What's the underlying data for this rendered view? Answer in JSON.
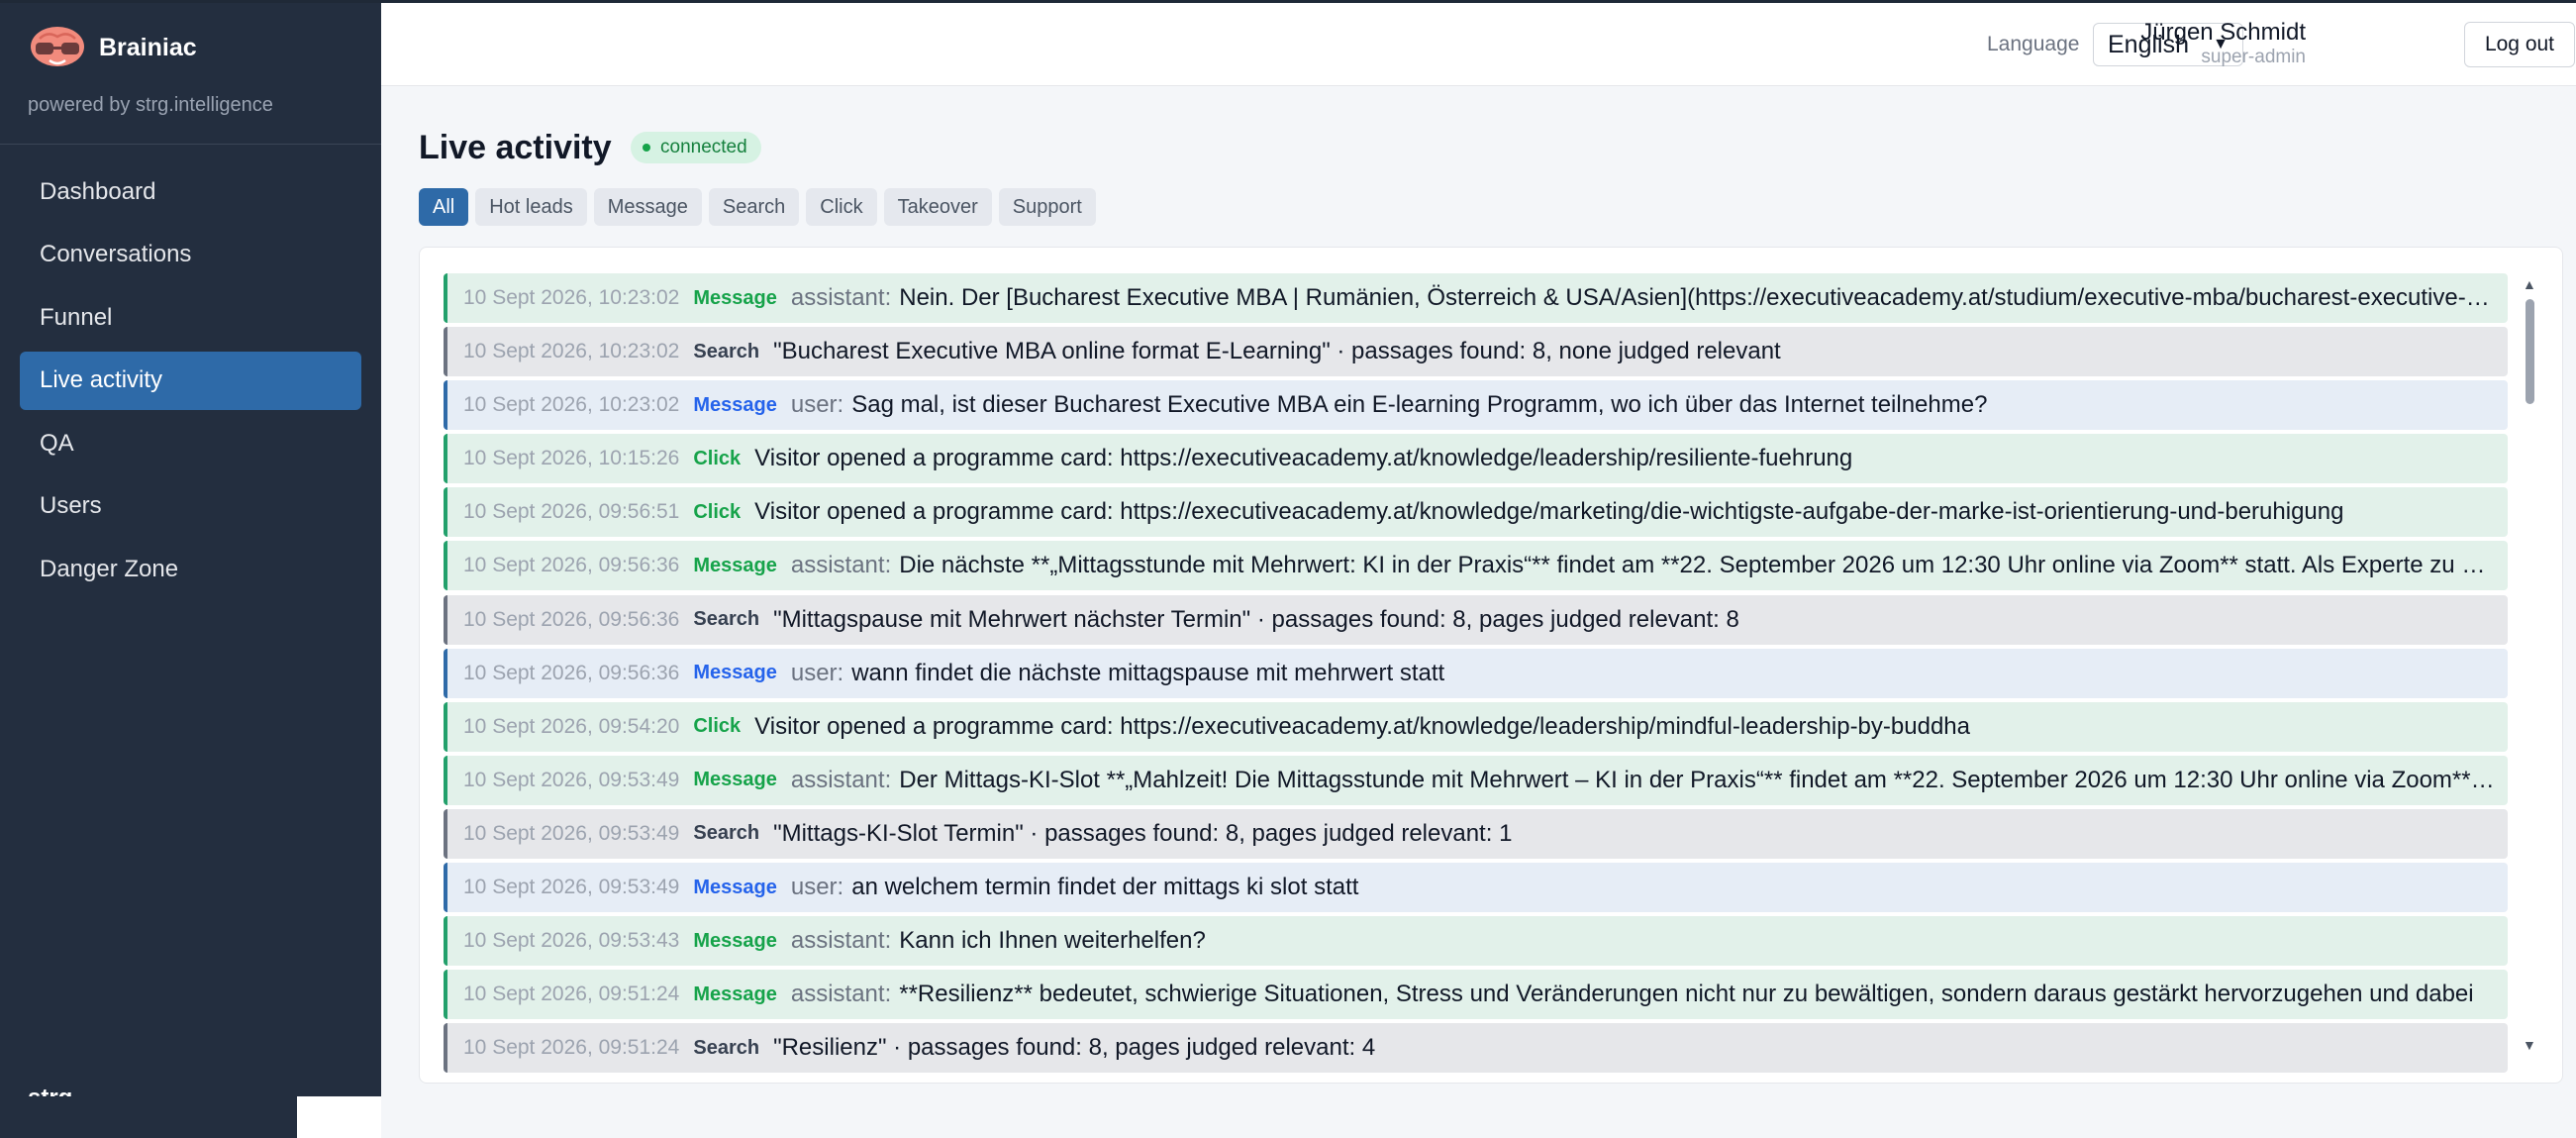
{
  "app": {
    "name": "Brainiac",
    "powered_by": "powered by strg.intelligence",
    "footer_logo": "strg"
  },
  "sidebar": {
    "items": [
      {
        "label": "Dashboard"
      },
      {
        "label": "Conversations"
      },
      {
        "label": "Funnel"
      },
      {
        "label": "Live activity",
        "active": true
      },
      {
        "label": "QA"
      },
      {
        "label": "Users"
      },
      {
        "label": "Danger Zone"
      }
    ]
  },
  "header": {
    "language_label": "Language",
    "language_value": "English",
    "user_name": "Jürgen Schmidt",
    "user_role": "super-admin",
    "logout_label": "Log out"
  },
  "page": {
    "title": "Live activity",
    "status": "connected"
  },
  "filters": [
    {
      "label": "All",
      "active": true
    },
    {
      "label": "Hot leads"
    },
    {
      "label": "Message"
    },
    {
      "label": "Search"
    },
    {
      "label": "Click"
    },
    {
      "label": "Takeover"
    },
    {
      "label": "Support"
    }
  ],
  "feed": [
    {
      "time": "10 Sept 2026, 10:23:02",
      "type": "Message",
      "role": "assistant:",
      "text": "Nein. Der [Bucharest Executive MBA | Rumänien, Österreich & USA/Asien](https://executiveacademy.at/studium/executive-mba/bucharest-executive-mba)"
    },
    {
      "time": "10 Sept 2026, 10:23:02",
      "type": "Search",
      "role": "",
      "text": "\"Bucharest Executive MBA online format E-Learning\" · passages found: 8, none judged relevant"
    },
    {
      "time": "10 Sept 2026, 10:23:02",
      "type": "Message",
      "role": "user:",
      "text": "Sag mal, ist dieser Bucharest Executive MBA ein E-learning Programm, wo ich über das Internet teilnehme?"
    },
    {
      "time": "10 Sept 2026, 10:15:26",
      "type": "Click",
      "role": "",
      "text": "Visitor opened a programme card: https://executiveacademy.at/knowledge/leadership/resiliente-fuehrung"
    },
    {
      "time": "10 Sept 2026, 09:56:51",
      "type": "Click",
      "role": "",
      "text": "Visitor opened a programme card: https://executiveacademy.at/knowledge/marketing/die-wichtigste-aufgabe-der-marke-ist-orientierung-und-beruhigung"
    },
    {
      "time": "10 Sept 2026, 09:56:36",
      "type": "Message",
      "role": "assistant:",
      "text": "Die nächste **„Mittagsstunde mit Mehrwert: KI in der Praxis“** findet am **22. September 2026 um 12:30 Uhr online via Zoom** statt. Als Experte zu Gast"
    },
    {
      "time": "10 Sept 2026, 09:56:36",
      "type": "Search",
      "role": "",
      "text": "\"Mittagspause mit Mehrwert nächster Termin\" · passages found: 8, pages judged relevant: 8"
    },
    {
      "time": "10 Sept 2026, 09:56:36",
      "type": "Message",
      "role": "user:",
      "text": "wann findet die nächste mittagspause mit mehrwert statt"
    },
    {
      "time": "10 Sept 2026, 09:54:20",
      "type": "Click",
      "role": "",
      "text": "Visitor opened a programme card: https://executiveacademy.at/knowledge/leadership/mindful-leadership-by-buddha"
    },
    {
      "time": "10 Sept 2026, 09:53:49",
      "type": "Message",
      "role": "assistant:",
      "text": "Der Mittags-KI-Slot **„Mahlzeit! Die Mittagsstunde mit Mehrwert – KI in der Praxis“** findet am **22. September 2026 um 12:30 Uhr online via Zoom** statt."
    },
    {
      "time": "10 Sept 2026, 09:53:49",
      "type": "Search",
      "role": "",
      "text": "\"Mittags-KI-Slot Termin\" · passages found: 8, pages judged relevant: 1"
    },
    {
      "time": "10 Sept 2026, 09:53:49",
      "type": "Message",
      "role": "user:",
      "text": "an welchem termin findet der mittags ki slot statt"
    },
    {
      "time": "10 Sept 2026, 09:53:43",
      "type": "Message",
      "role": "assistant:",
      "text": "Kann ich Ihnen weiterhelfen?"
    },
    {
      "time": "10 Sept 2026, 09:51:24",
      "type": "Message",
      "role": "assistant:",
      "text": "**Resilienz** bedeutet, schwierige Situationen, Stress und Veränderungen nicht nur zu bewältigen, sondern daraus gestärkt hervorzugehen und dabei"
    },
    {
      "time": "10 Sept 2026, 09:51:24",
      "type": "Search",
      "role": "",
      "text": "\"Resilienz\" · passages found: 8, pages judged relevant: 4"
    }
  ]
}
